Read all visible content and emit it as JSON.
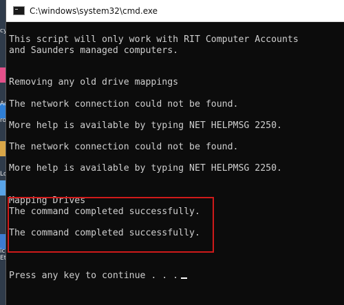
{
  "window": {
    "title": "C:\\windows\\system32\\cmd.exe"
  },
  "desktop": {
    "labels": [
      "cy",
      "Ad",
      "ro",
      "Lo",
      "ic",
      "Et"
    ]
  },
  "console": {
    "lines": [
      "This script will only work with RIT Computer Accounts",
      "and Saunders managed computers.",
      "",
      "",
      "Removing any old drive mappings",
      "",
      "The network connection could not be found.",
      "",
      "More help is available by typing NET HELPMSG 2250.",
      "",
      "The network connection could not be found.",
      "",
      "More help is available by typing NET HELPMSG 2250.",
      "",
      "",
      "Mapping Drives",
      "The command completed successfully.",
      "",
      "The command completed successfully.",
      "",
      "",
      "",
      "Press any key to continue . . ."
    ]
  },
  "colors": {
    "console_bg": "#0c0c0c",
    "console_text": "#cfcfcf",
    "highlight": "#d11a1a"
  }
}
